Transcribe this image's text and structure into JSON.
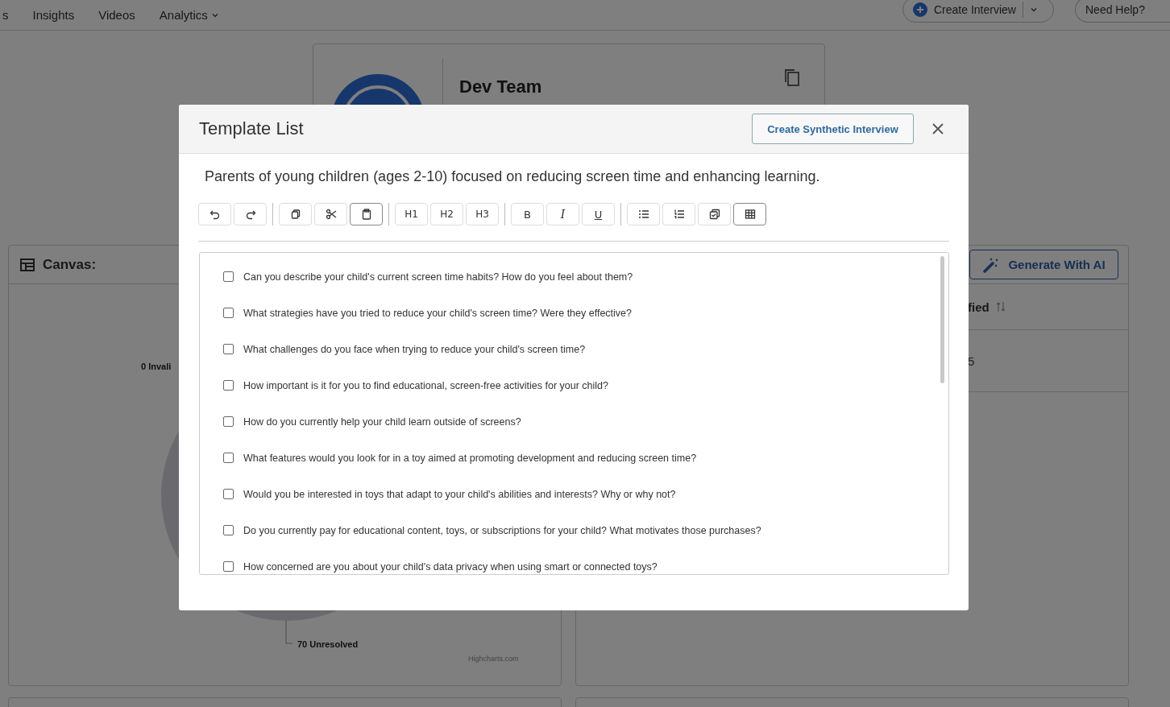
{
  "nav": {
    "tabs": [
      {
        "label": "s",
        "menu": false
      },
      {
        "label": "Insights",
        "menu": false
      },
      {
        "label": "Videos",
        "menu": false
      },
      {
        "label": "Analytics",
        "menu": true
      }
    ],
    "create_button": "Create Interview",
    "help_button": "Need Help?"
  },
  "team_card": {
    "name": "Dev Team"
  },
  "canvas_card": {
    "title": "Canvas:",
    "pie_labels": [
      "0 Invali",
      "70 Unresolved"
    ],
    "credit": "Highcharts.com"
  },
  "table_card": {
    "ai_button": "Generate With AI",
    "column_header": "fied",
    "cell": "5"
  },
  "modal": {
    "title": "Template List",
    "action_button": "Create Synthetic Interview",
    "subtitle": "Parents of young children (ages 2-10) focused on reducing screen time and enhancing learning.",
    "toolbar": [
      [
        {
          "kind": "undo",
          "active": false
        },
        {
          "kind": "redo",
          "active": false
        }
      ],
      [
        {
          "kind": "copy",
          "active": false
        },
        {
          "kind": "cut",
          "active": false
        },
        {
          "kind": "paste",
          "active": true
        }
      ],
      [
        {
          "kind": "text",
          "label": "H1",
          "active": false
        },
        {
          "kind": "text",
          "label": "H2",
          "active": false
        },
        {
          "kind": "text",
          "label": "H3",
          "active": false
        }
      ],
      [
        {
          "kind": "bold",
          "label": "B",
          "active": false
        },
        {
          "kind": "italic",
          "label": "I",
          "active": false
        },
        {
          "kind": "underline",
          "label": "U",
          "active": false
        }
      ],
      [
        {
          "kind": "bullets",
          "active": false
        },
        {
          "kind": "numbers",
          "active": false
        },
        {
          "kind": "checklist",
          "active": false
        },
        {
          "kind": "table",
          "active": true
        }
      ]
    ],
    "questions": [
      {
        "text": "Can you describe your child's current screen time habits? How do you feel about them?",
        "checked": false
      },
      {
        "text": "What strategies have you tried to reduce your child's screen time? Were they effective?",
        "checked": false
      },
      {
        "text": "What challenges do you face when trying to reduce your child's screen time?",
        "checked": false
      },
      {
        "text": "How important is it for you to find educational, screen-free activities for your child?",
        "checked": false
      },
      {
        "text": "How do you currently help your child learn outside of screens?",
        "checked": false
      },
      {
        "text": "What features would you look for in a toy aimed at promoting development and reducing screen time?",
        "checked": false
      },
      {
        "text": "Would you be interested in toys that adapt to your child's abilities and interests? Why or why not?",
        "checked": false
      },
      {
        "text": "Do you currently pay for educational content, toys, or subscriptions for your child? What motivates those purchases?",
        "checked": false
      },
      {
        "text": "How concerned are you about your child's data privacy when using smart or connected toys?",
        "checked": false
      }
    ]
  }
}
